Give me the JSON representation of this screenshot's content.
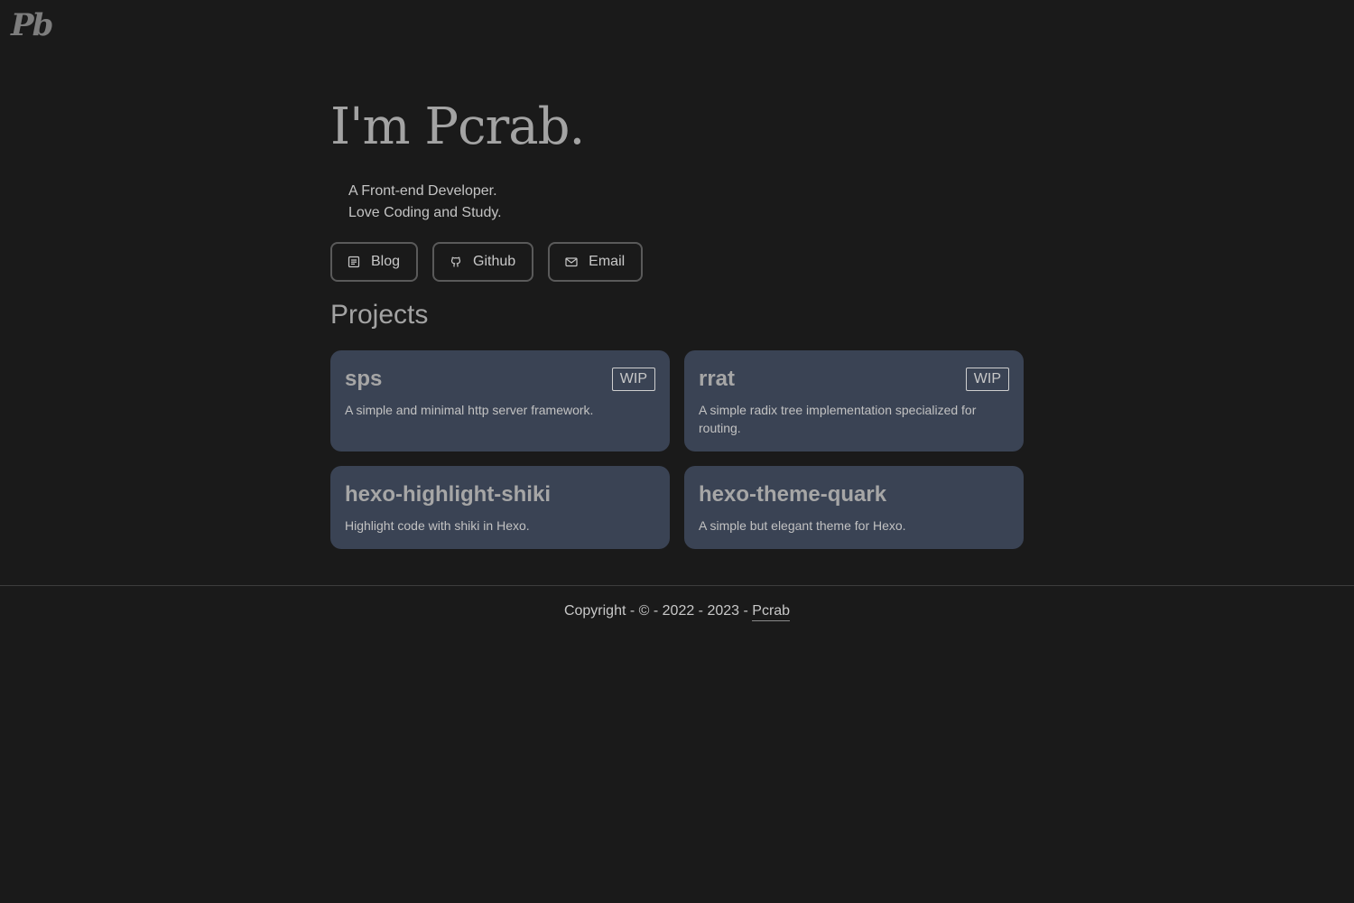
{
  "logo": {
    "text": "Pb"
  },
  "hero": {
    "title": "I'm Pcrab.",
    "bio": [
      "A Front-end Developer.",
      "Love Coding and Study."
    ]
  },
  "links": [
    {
      "label": "Blog",
      "icon": "document-icon"
    },
    {
      "label": "Github",
      "icon": "github-icon"
    },
    {
      "label": "Email",
      "icon": "mail-icon"
    }
  ],
  "projects": {
    "heading": "Projects",
    "items": [
      {
        "name": "sps",
        "badge": "WIP",
        "description": "A simple and minimal http server framework."
      },
      {
        "name": "rrat",
        "badge": "WIP",
        "description": "A simple radix tree implementation specialized for routing."
      },
      {
        "name": "hexo-highlight-shiki",
        "badge": "",
        "description": "Highlight code with shiki in Hexo."
      },
      {
        "name": "hexo-theme-quark",
        "badge": "",
        "description": "A simple but elegant theme for Hexo."
      }
    ]
  },
  "footer": {
    "prefix": "Copyright - © - 2022 - 2023 - ",
    "author": "Pcrab"
  },
  "colors": {
    "background": "#1a1a1a",
    "card": "#3a4354",
    "text": "#a3a3a3"
  }
}
